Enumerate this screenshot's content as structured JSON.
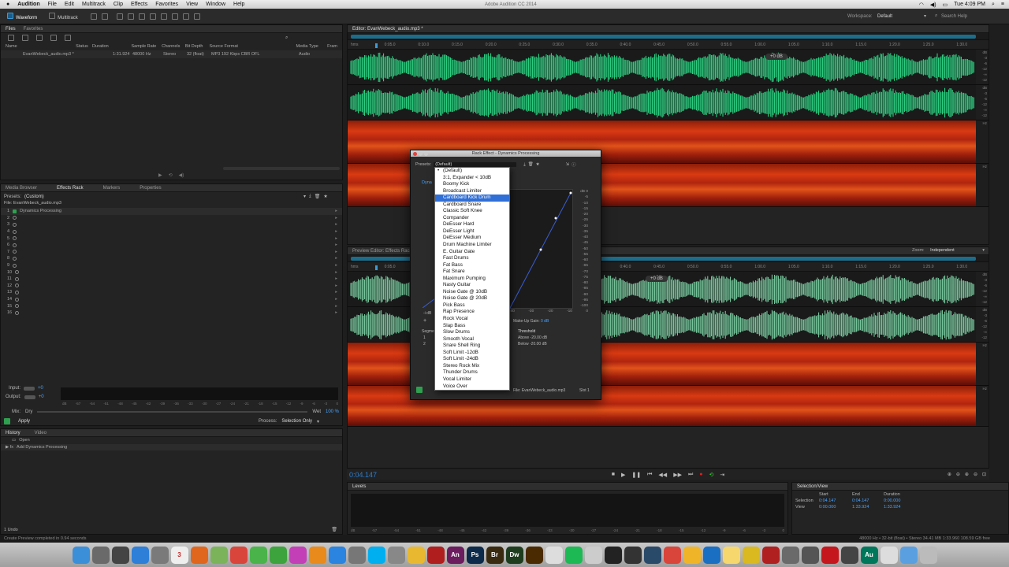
{
  "menubar": {
    "apple": "",
    "app": "Audition",
    "items": [
      "File",
      "Edit",
      "Multitrack",
      "Clip",
      "Effects",
      "Favorites",
      "View",
      "Window",
      "Help"
    ],
    "title": "Adobe Audition CC 2014",
    "clock": "Tue 4:09 PM"
  },
  "toolbar": {
    "waveform": "Waveform",
    "multitrack": "Multitrack",
    "workspace_label": "Workspace:",
    "workspace_value": "Default",
    "search": "Search Help"
  },
  "files": {
    "tabs": [
      "Files",
      "Favorites"
    ],
    "columns": [
      "Name",
      "Status",
      "Duration",
      "Sample Rate",
      "Channels",
      "Bit Depth",
      "Source Format",
      "Media Type",
      "Fram"
    ],
    "row": [
      "EvanWebeck_audio.mp3 *",
      "",
      "1:31.924",
      "48000 Hz",
      "Stereo",
      "32 (float)",
      "MP3 192 Kbps CBR OFL",
      "Audio"
    ]
  },
  "effects": {
    "tabs": [
      "Media Browser",
      "Effects Rack",
      "Markers",
      "Properties"
    ],
    "presets_label": "Presets:",
    "presets_value": "(Custom)",
    "file": "File: EvanWebeck_audio.mp3",
    "slot1": "Dynamics Processing",
    "slots": [
      "1",
      "2",
      "3",
      "4",
      "5",
      "6",
      "7",
      "8",
      "9",
      "10",
      "11",
      "12",
      "13",
      "14",
      "15",
      "16"
    ],
    "input": "Input:",
    "output": "Output:",
    "mix": "Mix:",
    "dry": "Dry",
    "wet": "Wet",
    "wet_pct": "100 %",
    "apply": "Apply",
    "process_label": "Process:",
    "process_value": "Selection Only",
    "meter_ticks": [
      "dB",
      "-57",
      "-54",
      "-51",
      "-48",
      "-45",
      "-42",
      "-39",
      "-36",
      "-33",
      "-30",
      "-27",
      "-24",
      "-21",
      "-18",
      "-15",
      "-12",
      "-9",
      "-6",
      "-3",
      "0"
    ]
  },
  "history": {
    "tabs": [
      "History",
      "Video"
    ],
    "items": [
      "Open",
      "Add Dynamics Processing"
    ],
    "undo": "1 Undo"
  },
  "status": {
    "left": "Create Preview completed in 0.94 seconds",
    "right": "48000 Hz • 32-bit (float) • Stereo    34.41 MB    1:33.960    108.59 GB free"
  },
  "editor": {
    "tab": "Editor: EvanWebeck_audio.mp3 *",
    "ruler": [
      "hms",
      "0:05.0",
      "0:10.0",
      "0:15.0",
      "0:20.0",
      "0:25.0",
      "0:30.0",
      "0:35.0",
      "0:40.0",
      "0:45.0",
      "0:50.0",
      "0:55.0",
      "1:00.0",
      "1:05.0",
      "1:10.0",
      "1:15.0",
      "1:20.0",
      "1:25.0",
      "1:30.0"
    ],
    "hud": "+0 dB",
    "db_scale": [
      "dB",
      "-3",
      "-6",
      "-12",
      "-∞",
      "-12",
      "-6",
      "-3"
    ],
    "hz": "Hz"
  },
  "preview": {
    "tab": "Preview Editor: Effects Rack",
    "zoom_label": "Zoom:",
    "zoom_value": "Independent",
    "hud": "+0 dB"
  },
  "transport": {
    "timecode": "0:04.147"
  },
  "levels": {
    "tab": "Levels",
    "ticks": [
      "dB",
      "-57",
      "-54",
      "-51",
      "-48",
      "-45",
      "-42",
      "-39",
      "-36",
      "-33",
      "-30",
      "-27",
      "-24",
      "-21",
      "-18",
      "-15",
      "-12",
      "-9",
      "-6",
      "-3",
      "0"
    ]
  },
  "selview": {
    "tab": "Selection/View",
    "headers": [
      "Start",
      "End",
      "Duration"
    ],
    "selection_label": "Selection",
    "selection": [
      "0:04.147",
      "0:04.147",
      "0:00.000"
    ],
    "view_label": "View",
    "view": [
      "0:00.000",
      "1:33.924",
      "1:33.924"
    ]
  },
  "dialog": {
    "title": "Rack Effect - Dynamics Processing",
    "presets_label": "Presets:",
    "presets_value": "(Default)",
    "tab": "Dyna",
    "graph_scale": [
      "dB 0",
      "-5",
      "-10",
      "-15",
      "-20",
      "-25",
      "-30",
      "-35",
      "-40",
      "-45",
      "-50",
      "-55",
      "-60",
      "-65",
      "-70",
      "-75",
      "-80",
      "-85",
      "-90",
      "-95",
      "-100"
    ],
    "x_scale": [
      "-40",
      "-30",
      "-20",
      "-10",
      "0"
    ],
    "idb": "-i dB",
    "makeup": "Make-Up Gain:",
    "makeup_val": "0 dB",
    "segment": "Segment",
    "segments": [
      "1",
      "2"
    ],
    "threshold": "Threshold",
    "above": "Above -20.00 dB",
    "below": "Below -20.00 dB",
    "file": "File: EvanWebeck_audio.mp3",
    "slot": "Slot 1"
  },
  "preset_list": {
    "items": [
      "(Default)",
      "3:1, Expander < 10dB",
      "Boomy Kick",
      "Broadcast Limiter",
      "Cardboard Kick Drum",
      "Cardboard Snare",
      "Classic Soft Knee",
      "Compander",
      "DeEsser Hard",
      "DeEsser Light",
      "DeEsser Medium",
      "Drum Machine Limiter",
      "E. Guitar Gate",
      "Fast Drums",
      "Fat Bass",
      "Fat Snare",
      "Maximum Pumping",
      "Nasty Guitar",
      "Noise Gate @ 10dB",
      "Noise Gate @ 20dB",
      "Pick Bass",
      "Rap Presence",
      "Rock Vocal",
      "Slap Bass",
      "Slow Drums",
      "Smooth Vocal",
      "Snare Shell Ring",
      "Soft Limit -12dB",
      "Soft Limit -24dB",
      "Stereo Rock Mix",
      "Thunder Drums",
      "Vocal Limiter",
      "Voice Over"
    ],
    "selected": "(Default)",
    "highlighted": "Cardboard Kick Drum"
  },
  "dock": {
    "apps": [
      {
        "name": "Finder",
        "color": "#3b8fd9",
        "label": ""
      },
      {
        "name": "Launchpad",
        "color": "#6a6a6a",
        "label": ""
      },
      {
        "name": "Mission Control",
        "color": "#444",
        "label": ""
      },
      {
        "name": "Safari",
        "color": "#2d7fd8",
        "label": ""
      },
      {
        "name": "Mail",
        "color": "#7a7a7a",
        "label": ""
      },
      {
        "name": "Calendar",
        "color": "#eee",
        "label": "3"
      },
      {
        "name": "Firefox",
        "color": "#e0661d",
        "label": ""
      },
      {
        "name": "Maps",
        "color": "#7bb35a",
        "label": ""
      },
      {
        "name": "Chrome",
        "color": "#d9453b",
        "label": ""
      },
      {
        "name": "Messages",
        "color": "#4ab34a",
        "label": ""
      },
      {
        "name": "FaceTime",
        "color": "#3da33d",
        "label": ""
      },
      {
        "name": "iTunes",
        "color": "#c33fb8",
        "label": ""
      },
      {
        "name": "iBooks",
        "color": "#e88a1c",
        "label": ""
      },
      {
        "name": "App Store",
        "color": "#2a84e0",
        "label": ""
      },
      {
        "name": "System Preferences",
        "color": "#777",
        "label": ""
      },
      {
        "name": "Skype",
        "color": "#00aff0",
        "label": ""
      },
      {
        "name": "Photos",
        "color": "#888",
        "label": ""
      },
      {
        "name": "Preview",
        "color": "#e8b830",
        "label": ""
      },
      {
        "name": "Acrobat",
        "color": "#b01e1e",
        "label": ""
      },
      {
        "name": "Animate",
        "color": "#6b1d5e",
        "label": "An"
      },
      {
        "name": "Photoshop",
        "color": "#0d2a4a",
        "label": "Ps"
      },
      {
        "name": "Bridge",
        "color": "#3a2a10",
        "label": "Br"
      },
      {
        "name": "Dreamweaver",
        "color": "#1e3d1e",
        "label": "Dw"
      },
      {
        "name": "Illustrator",
        "color": "#4a2a00",
        "label": ""
      },
      {
        "name": "Finder2",
        "color": "#ddd",
        "label": ""
      },
      {
        "name": "Spotify",
        "color": "#1db954",
        "label": ""
      },
      {
        "name": "TextEdit",
        "color": "#ccc",
        "label": ""
      },
      {
        "name": "Terminal",
        "color": "#222",
        "label": ""
      },
      {
        "name": "Activity",
        "color": "#333",
        "label": ""
      },
      {
        "name": "Time Machine",
        "color": "#2a4a6a",
        "label": ""
      },
      {
        "name": "Chrome2",
        "color": "#d9453b",
        "label": ""
      },
      {
        "name": "Sketch",
        "color": "#f0b429",
        "label": ""
      },
      {
        "name": "Xcode",
        "color": "#1a6fc2",
        "label": ""
      },
      {
        "name": "Notes",
        "color": "#f5d76e",
        "label": ""
      },
      {
        "name": "Cyberduck",
        "color": "#d9b820",
        "label": ""
      },
      {
        "name": "FileZilla",
        "color": "#b02020",
        "label": ""
      },
      {
        "name": "Audition2",
        "color": "#6a6a6a",
        "label": ""
      },
      {
        "name": "Calc",
        "color": "#555",
        "label": ""
      },
      {
        "name": "Acrobat2",
        "color": "#c4161c",
        "label": ""
      },
      {
        "name": "Unknown",
        "color": "#444",
        "label": ""
      },
      {
        "name": "Audition",
        "color": "#00775a",
        "label": "Au"
      },
      {
        "name": "Docs",
        "color": "#ddd",
        "label": ""
      },
      {
        "name": "Folder",
        "color": "#5aa0e0",
        "label": ""
      },
      {
        "name": "Trash",
        "color": "#bbb",
        "label": ""
      }
    ]
  },
  "colors": {
    "waveform": "#2fe08a",
    "preview_waveform": "#7fd6a8",
    "accent": "#2f6fd6",
    "timecode": "#2a7fd4"
  }
}
